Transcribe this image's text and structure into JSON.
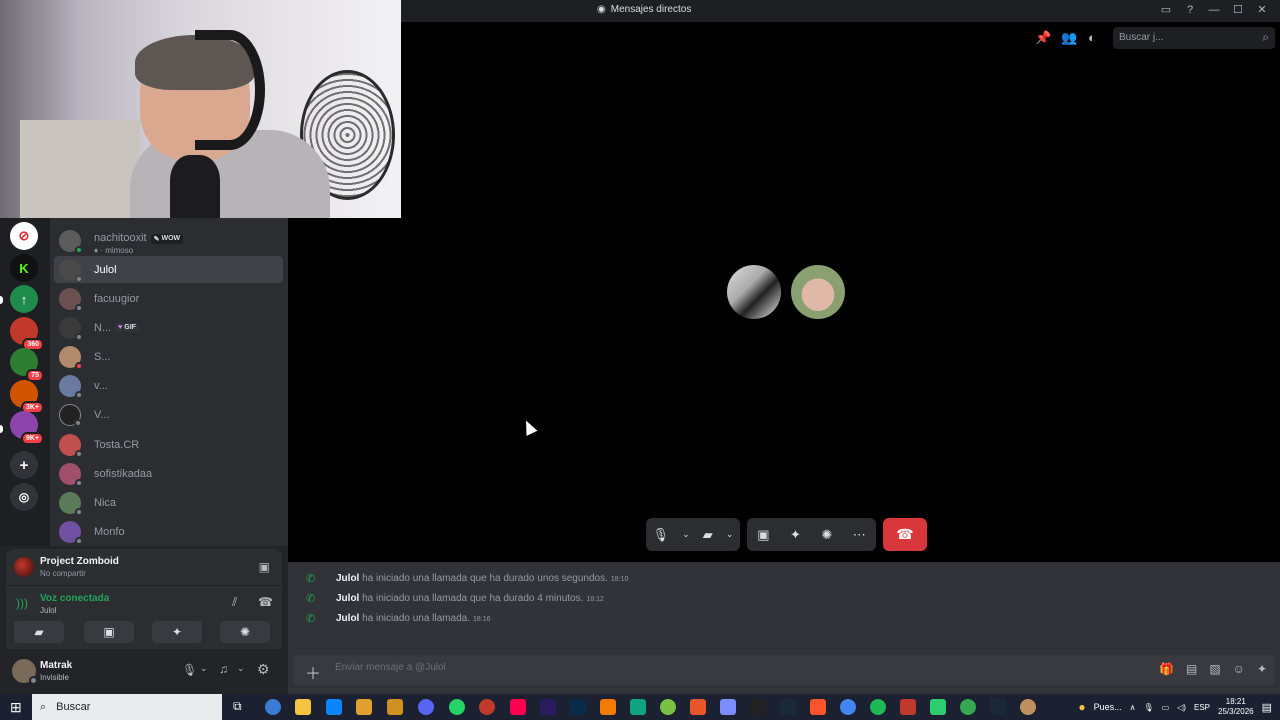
{
  "window": {
    "title": "Mensajes directos"
  },
  "header": {
    "search_placeholder": "Buscar j..."
  },
  "servers": [
    {
      "name": "server-red",
      "badge": ""
    },
    {
      "name": "server-kick",
      "badge": ""
    },
    {
      "name": "server-green",
      "badge": ""
    },
    {
      "name": "server-360",
      "badge": "360"
    },
    {
      "name": "server-75",
      "badge": "75"
    },
    {
      "name": "server-3k",
      "badge": "3K+"
    },
    {
      "name": "server-9k",
      "badge": "9K+"
    }
  ],
  "dms": [
    {
      "name": "nachitooxit",
      "tag": "WOW",
      "sub": "mimoso",
      "color": "#5c5c5c"
    },
    {
      "name": "Julol",
      "color": "#4a4a4a"
    },
    {
      "name": "facuugior",
      "color": "#6a5050"
    },
    {
      "name": "N...",
      "tag": "GIF",
      "color": "#3a3a3a"
    },
    {
      "name": "S...",
      "color": "#b08a6a"
    },
    {
      "name": "v...",
      "color": "#6a7aa0"
    },
    {
      "name": "V...",
      "color": "#222"
    },
    {
      "name": "Tosta.CR",
      "color": "#c05050"
    },
    {
      "name": "sofistikadaa",
      "color": "#a0506a"
    },
    {
      "name": "Nica",
      "color": "#5a7a5a"
    },
    {
      "name": "Monfo",
      "color": "#7050a0"
    }
  ],
  "activity": {
    "game": "Project Zomboid",
    "status": "No compartir"
  },
  "voice": {
    "status": "Voz conectada",
    "channel": "Julol"
  },
  "user": {
    "name": "Matrak",
    "status": "Invisible"
  },
  "messages": [
    {
      "author": "Julol",
      "text": "ha iniciado una llamada que ha durado unos segundos.",
      "time": "18:10"
    },
    {
      "author": "Julol",
      "text": "ha iniciado una llamada que ha durado 4 minutos.",
      "time": "18:12"
    },
    {
      "author": "Julol",
      "text": "ha iniciado una llamada.",
      "time": "18:16"
    }
  ],
  "composer": {
    "placeholder": "Enviar mensaje a @Julol"
  },
  "taskbar": {
    "search_label": "Buscar",
    "weather": "Pues...",
    "lang": "ESP",
    "time": "18:21",
    "date": "25/3/2026"
  },
  "colors": {
    "accent_green": "#23a55a",
    "hangup_red": "#da373c",
    "sidebar": "#2b2d31"
  }
}
